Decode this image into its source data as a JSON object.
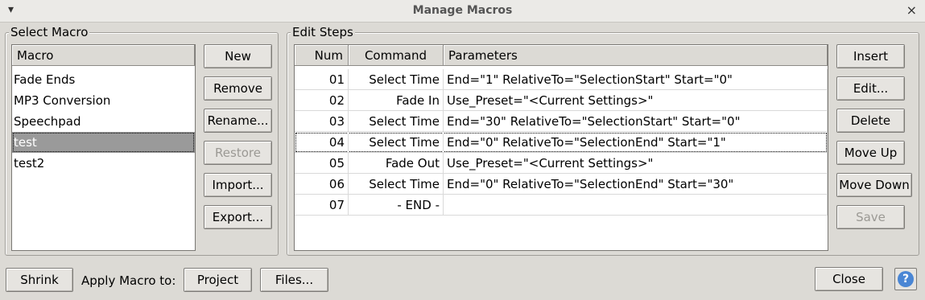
{
  "window": {
    "title": "Manage Macros",
    "menu_glyph": "▾",
    "close_glyph": "×"
  },
  "select_macro": {
    "group_label": "Select Macro",
    "column_header": "Macro",
    "items": [
      "Fade Ends",
      "MP3 Conversion",
      "Speechpad",
      "test",
      "test2"
    ],
    "selected": "test",
    "buttons": {
      "new": "New",
      "remove": "Remove",
      "rename": "Rename...",
      "restore": "Restore",
      "import": "Import...",
      "export": "Export..."
    }
  },
  "edit_steps": {
    "group_label": "Edit Steps",
    "headers": {
      "num": "Num",
      "command": "Command",
      "parameters": "Parameters"
    },
    "rows": [
      {
        "num": "01",
        "command": "Select Time",
        "parameters": "End=\"1\" RelativeTo=\"SelectionStart\" Start=\"0\""
      },
      {
        "num": "02",
        "command": "Fade In",
        "parameters": "Use_Preset=\"<Current Settings>\""
      },
      {
        "num": "03",
        "command": "Select Time",
        "parameters": "End=\"30\" RelativeTo=\"SelectionStart\" Start=\"0\""
      },
      {
        "num": "04",
        "command": "Select Time",
        "parameters": "End=\"0\" RelativeTo=\"SelectionEnd\" Start=\"1\""
      },
      {
        "num": "05",
        "command": "Fade Out",
        "parameters": "Use_Preset=\"<Current Settings>\""
      },
      {
        "num": "06",
        "command": "Select Time",
        "parameters": "End=\"0\" RelativeTo=\"SelectionEnd\" Start=\"30\""
      },
      {
        "num": "07",
        "command": "- END -",
        "parameters": ""
      }
    ],
    "focused_row": "04",
    "buttons": {
      "insert": "Insert",
      "edit": "Edit...",
      "delete": "Delete",
      "move_up": "Move Up",
      "move_down": "Move Down",
      "save": "Save"
    }
  },
  "bottom": {
    "shrink": "Shrink",
    "apply_label": "Apply Macro to:",
    "project": "Project",
    "files": "Files...",
    "close": "Close",
    "help_glyph": "?"
  },
  "colors": {
    "selection": "#9a9a9a",
    "help_accent": "#4a86d4"
  }
}
